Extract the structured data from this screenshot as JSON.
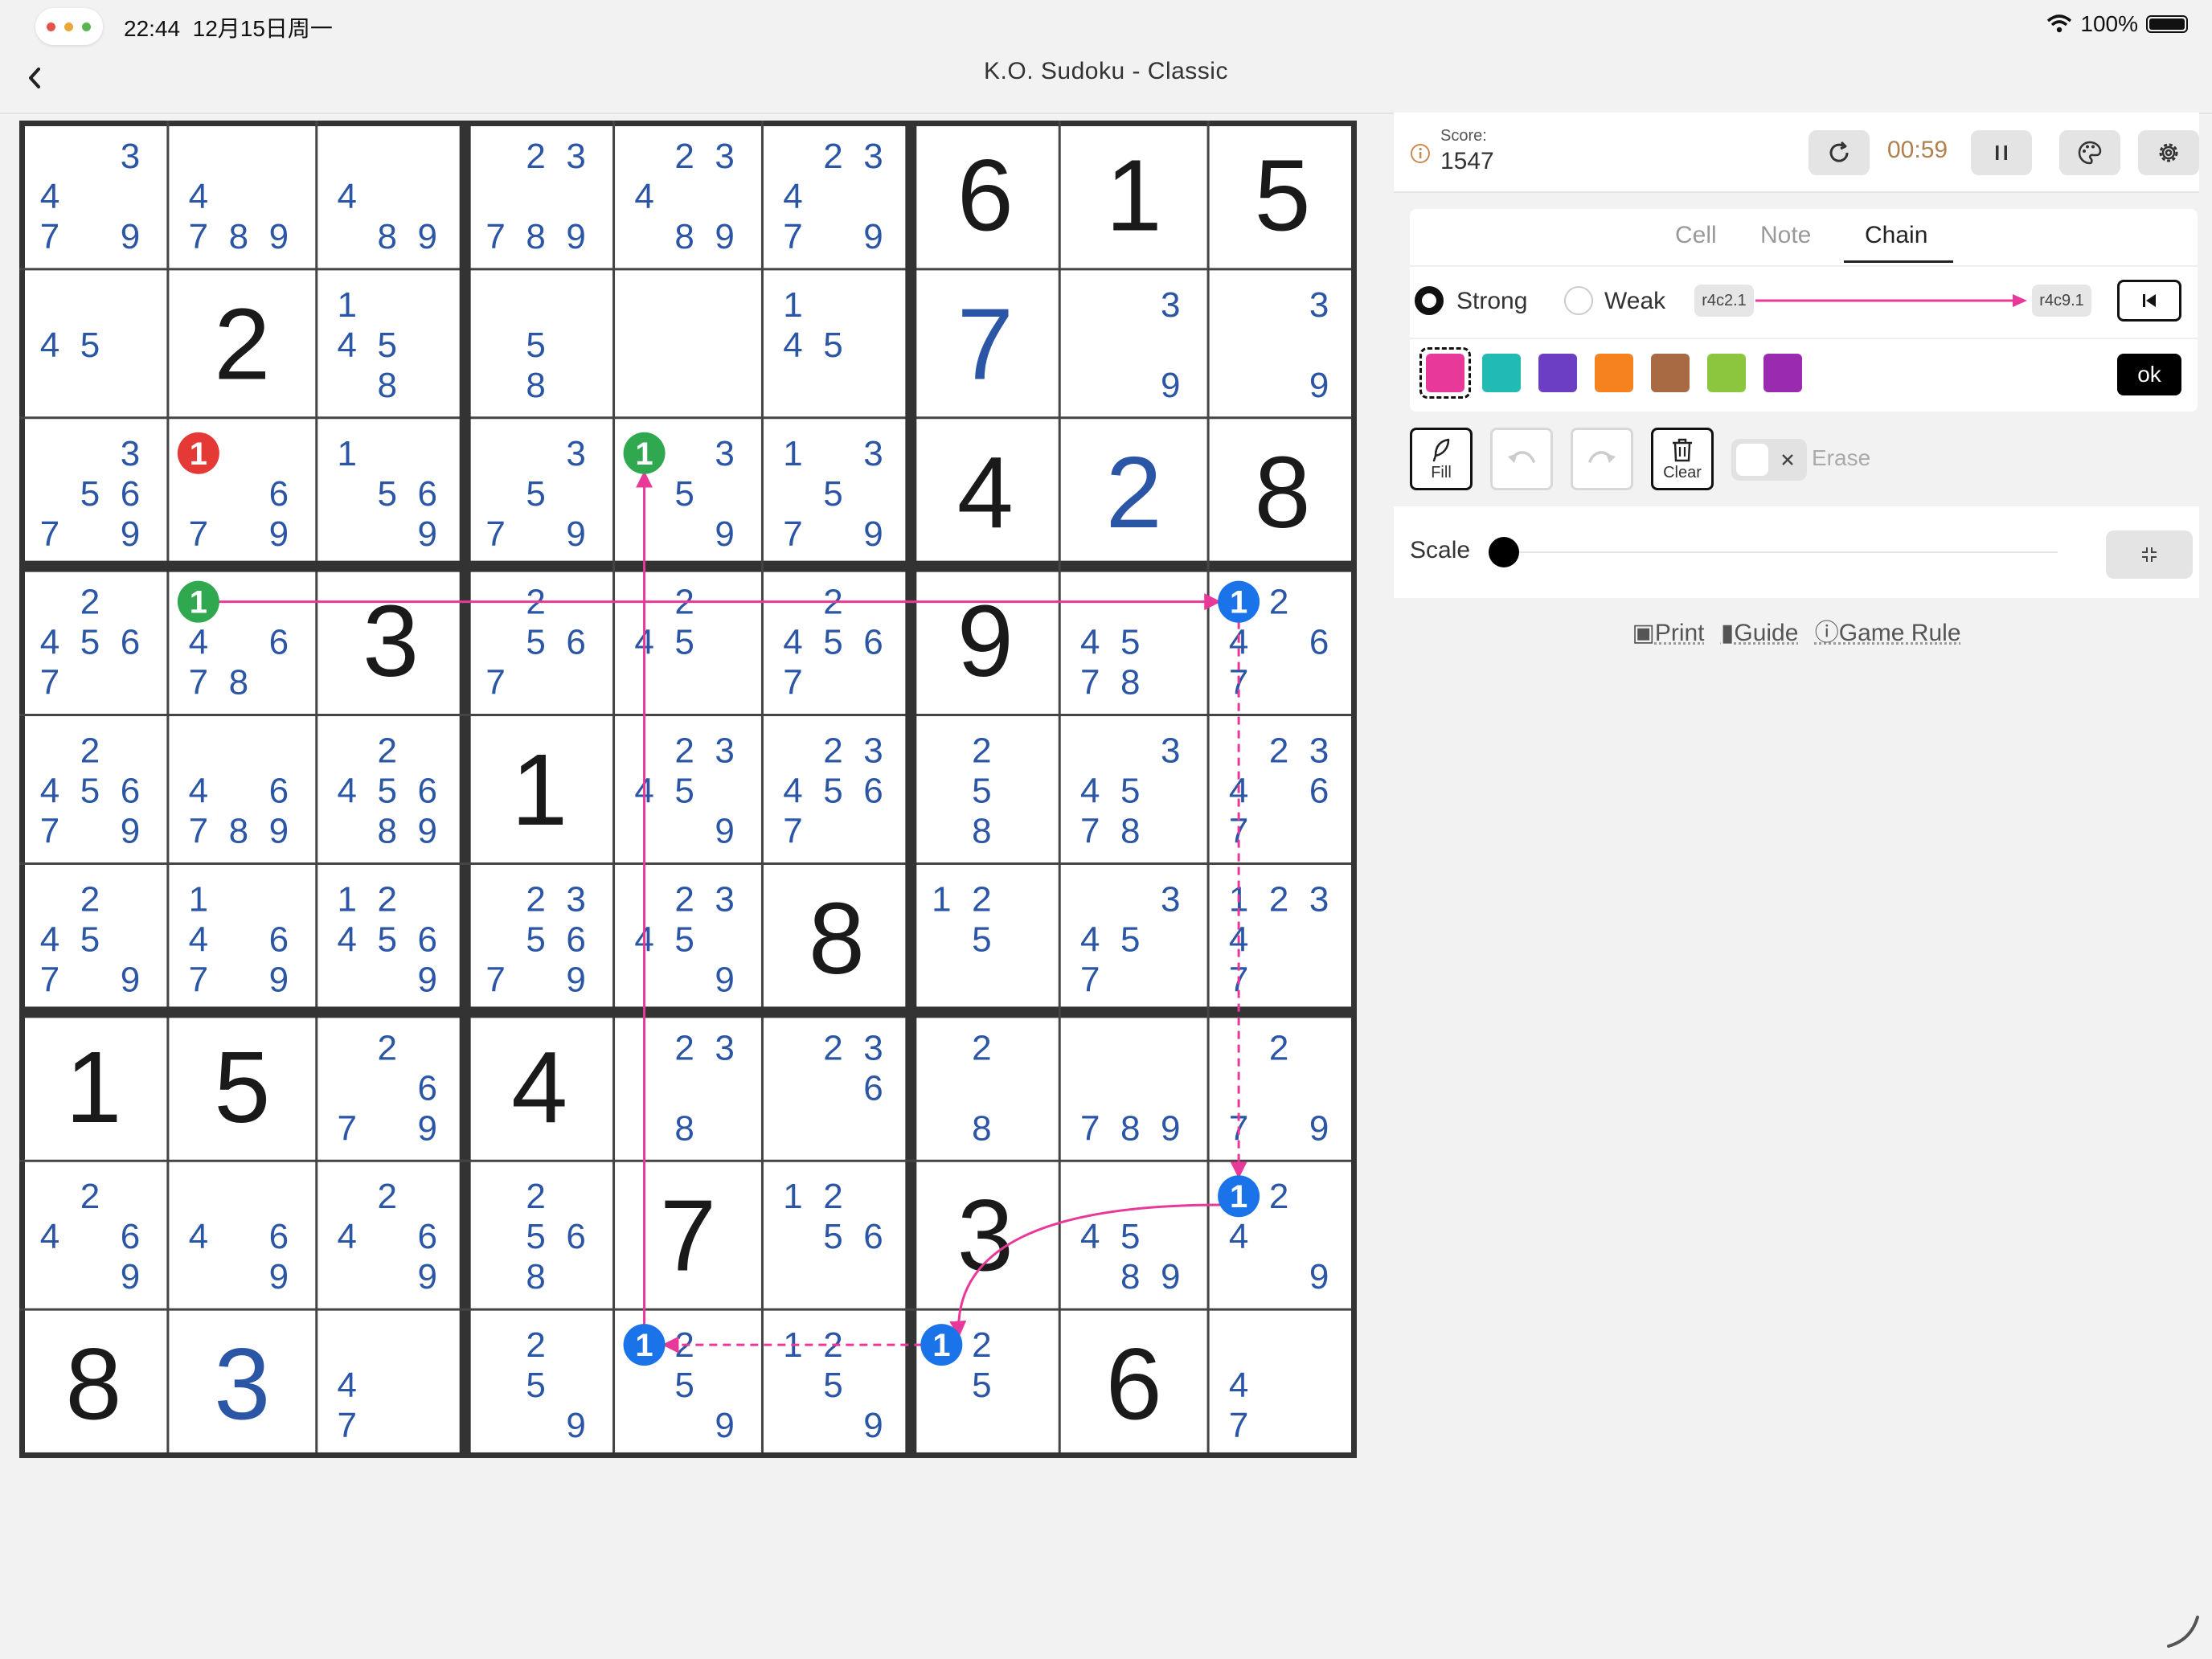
{
  "status_bar": {
    "time": "22:44",
    "date": "12月15日周一",
    "battery": "100%"
  },
  "header": {
    "title": "K.O. Sudoku - Classic"
  },
  "score": {
    "label": "Score:",
    "value": "1547",
    "timer": "00:59"
  },
  "tabs": [
    "Cell",
    "Note",
    "Chain"
  ],
  "active_tab": "Chain",
  "chain": {
    "strong_label": "Strong",
    "weak_label": "Weak",
    "start_cell": "r4c2.1",
    "end_cell": "r4c9.1",
    "ok_label": "ok"
  },
  "swatches": [
    "#e8399a",
    "#22bbb3",
    "#6b3ec4",
    "#f5821f",
    "#a86a43",
    "#8cc63f",
    "#9a2bb0"
  ],
  "tools": {
    "fill_label": "Fill",
    "clear_label": "Clear",
    "erase_label": "Erase"
  },
  "scale": {
    "label": "Scale",
    "value": 0
  },
  "footer": {
    "print_label": "Print",
    "guide_label": "Guide",
    "rule_label": "Game Rule"
  },
  "colors": {
    "accent": "#e8399a",
    "given": "#1a1a1a",
    "placed": "#2b55a5",
    "candidate": "#2b55a5",
    "timer": "#b08050"
  },
  "board": {
    "givens": [
      "000000615",
      "020000000",
      "000000408",
      "003000900",
      "000100000",
      "000008000",
      "150400000",
      "000070300",
      "800000060"
    ],
    "placed": [
      "000000600",
      "000000700",
      "000000020",
      "000000000",
      "000000000",
      "000000000",
      "000000000",
      "000000000",
      "030000000"
    ],
    "candidates": [
      [
        "3479",
        "4789",
        "489",
        "23789",
        "23489",
        "23479",
        "",
        "",
        ""
      ],
      [
        "45",
        "",
        "1458",
        "58",
        "",
        "145",
        "",
        "39",
        "39"
      ],
      [
        "35679",
        "1679",
        "1569",
        "3579",
        "1359",
        "13579",
        "",
        "",
        ""
      ],
      [
        "24567",
        "14678",
        "",
        "2567",
        "245",
        "24567",
        "",
        "4578",
        "12467"
      ],
      [
        "245679",
        "46789",
        "245689",
        "",
        "23459",
        "234567",
        "258",
        "34578",
        "23467"
      ],
      [
        "24579",
        "14679",
        "124569",
        "235679",
        "23459",
        "",
        "125",
        "3457",
        "12347"
      ],
      [
        "",
        "",
        "2679",
        "",
        "238",
        "236",
        "28",
        "789",
        "279"
      ],
      [
        "2469",
        "469",
        "2469",
        "2568",
        "",
        "1256",
        "",
        "4589",
        "1249"
      ],
      [
        "",
        "",
        "47",
        "259",
        "1259",
        "1259",
        "125",
        "",
        "47"
      ]
    ],
    "highlights": [
      {
        "r": 3,
        "c": 2,
        "d": 1,
        "color": "#e53935"
      },
      {
        "r": 3,
        "c": 5,
        "d": 1,
        "color": "#2fa84f"
      },
      {
        "r": 4,
        "c": 2,
        "d": 1,
        "color": "#2fa84f"
      },
      {
        "r": 4,
        "c": 9,
        "d": 1,
        "color": "#1a73e8"
      },
      {
        "r": 8,
        "c": 9,
        "d": 1,
        "color": "#1a73e8"
      },
      {
        "r": 9,
        "c": 5,
        "d": 1,
        "color": "#1a73e8"
      },
      {
        "r": 9,
        "c": 7,
        "d": 1,
        "color": "#1a73e8"
      }
    ],
    "links": [
      {
        "from": [
          4,
          2
        ],
        "to": [
          4,
          9
        ],
        "style": "strong"
      },
      {
        "from": [
          4,
          9
        ],
        "to": [
          8,
          9
        ],
        "style": "weak"
      },
      {
        "from": [
          8,
          9
        ],
        "to": [
          9,
          7
        ],
        "style": "strong"
      },
      {
        "from": [
          9,
          7
        ],
        "to": [
          9,
          5
        ],
        "style": "weak"
      },
      {
        "from": [
          9,
          5
        ],
        "to": [
          3,
          5
        ],
        "style": "strong"
      }
    ]
  }
}
